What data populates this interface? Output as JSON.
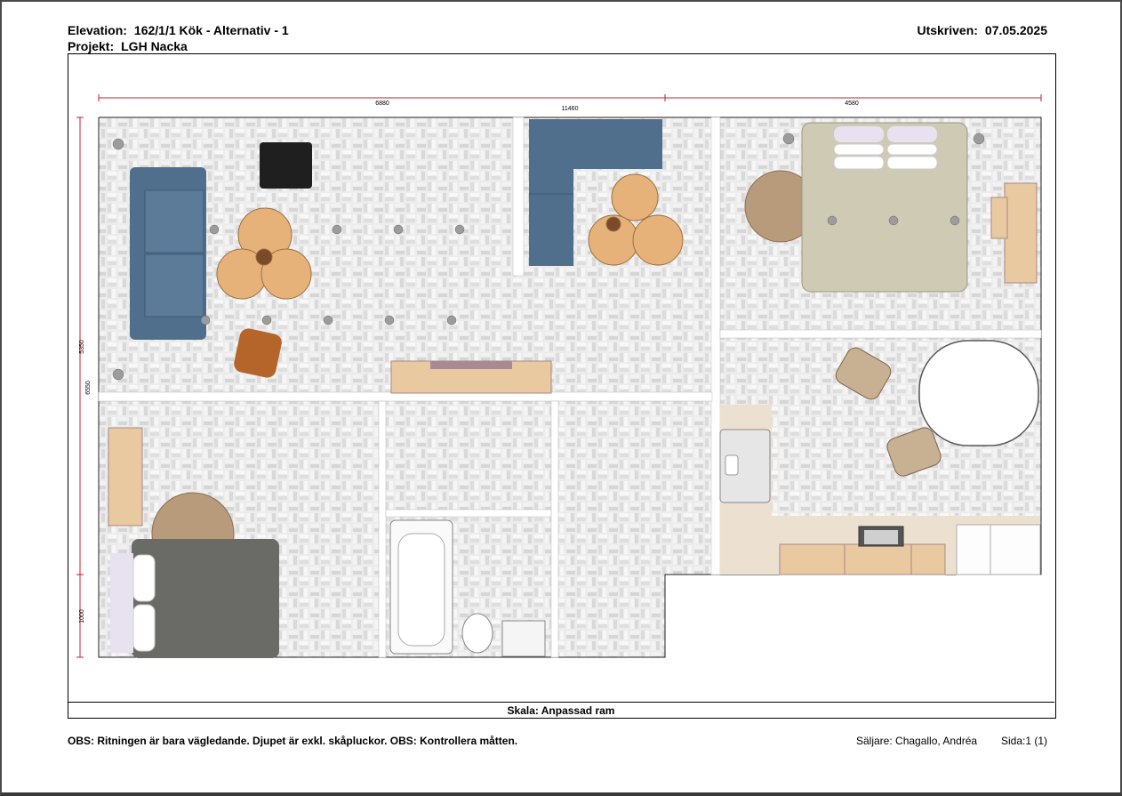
{
  "header": {
    "elevation_label": "Elevation:",
    "elevation_value": "162/1/1  Kök - Alternativ - 1",
    "project_label": "Projekt:",
    "project_value": "LGH Nacka",
    "printed_label": "Utskriven:",
    "printed_value": "07.05.2025"
  },
  "dimensions": {
    "top_left": "6880",
    "top_total": "11460",
    "top_right": "4580",
    "left_upper": "5350",
    "left_total": "6550",
    "left_lower": "1000"
  },
  "scale": {
    "text": "Skala: Anpassad ram"
  },
  "footer": {
    "obs": "OBS: Ritningen är bara vägledande. Djupet är exkl. skåpluckor. OBS: Kontrollera måtten.",
    "seller": "Säljare: Chagallo, Andréa",
    "page": "Sida:1 (1)"
  },
  "colors": {
    "floor": "#e6e6e6",
    "wall": "#ffffff",
    "sofa": "#4f6f8c",
    "table": "#e6b27a",
    "bed": "#cfcab3",
    "rug": "#b79b7a",
    "wood": "#e8c9a0",
    "dimension": "#c0202a"
  }
}
